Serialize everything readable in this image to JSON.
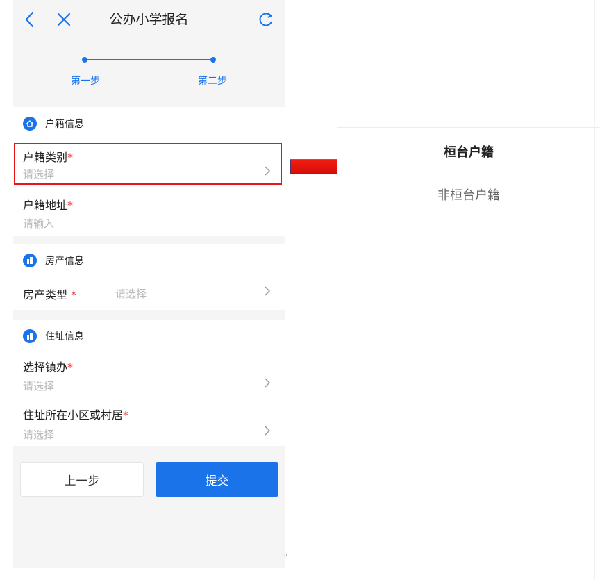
{
  "header": {
    "title": "公办小学报名",
    "back_icon": "chevron-left-icon",
    "close_icon": "close-icon",
    "refresh_icon": "refresh-icon"
  },
  "steps": [
    {
      "label": "第一步"
    },
    {
      "label": "第二步"
    }
  ],
  "sections": {
    "household": {
      "title": "户籍信息",
      "icon": "home-icon",
      "fields": [
        {
          "label": "户籍类别",
          "placeholder": "请选择"
        },
        {
          "label": "户籍地址",
          "placeholder": "请输入"
        }
      ]
    },
    "property": {
      "title": "房产信息",
      "icon": "building-icon",
      "fields": [
        {
          "label": "房产类型",
          "placeholder": "请选择"
        }
      ]
    },
    "residence": {
      "title": "住址信息",
      "icon": "residence-icon",
      "fields": [
        {
          "label": "选择镇办",
          "placeholder": "请选择"
        },
        {
          "label": "住址所在小区或村居",
          "placeholder": "请选择"
        }
      ]
    }
  },
  "required_mark": "*",
  "buttons": {
    "prev": "上一步",
    "submit": "提交"
  },
  "picker": {
    "options": [
      "桓台户籍",
      "非桓台户籍"
    ]
  },
  "stray_mark": "ᐡ",
  "colors": {
    "accent": "#1a73e8",
    "required": "#e53935",
    "highlight": "#e8141a"
  }
}
